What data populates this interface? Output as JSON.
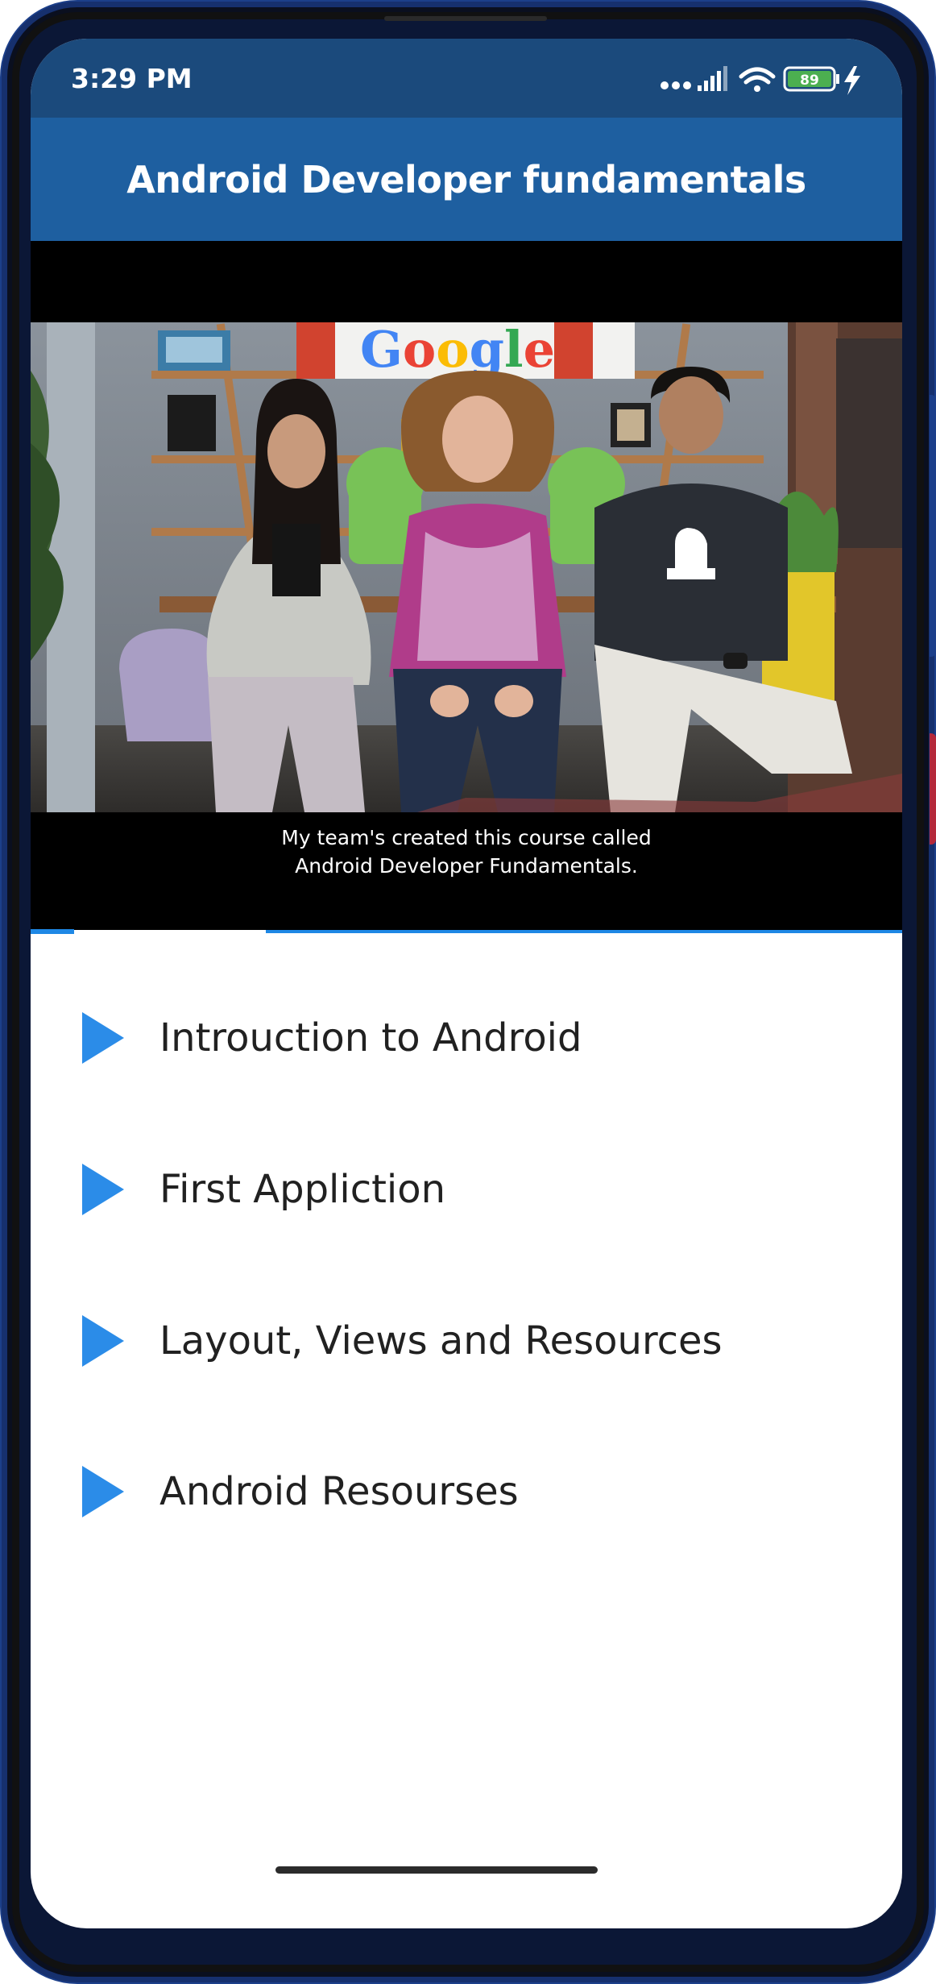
{
  "status_bar": {
    "time": "3:29 PM",
    "battery_level": "89",
    "icons": [
      "dots-icon",
      "signal-icon",
      "wifi-icon",
      "battery-icon",
      "charging-icon"
    ]
  },
  "app_bar": {
    "title": "Android Developer fundamentals"
  },
  "video": {
    "caption_line1": "My team's created this course called",
    "caption_line2": "Android Developer Fundamentals.",
    "progress_played": 0.05,
    "progress_buffered": 0.27,
    "scene_logo_text": "Google"
  },
  "lessons": [
    {
      "label": "Introuction to Android",
      "icon": "play-icon"
    },
    {
      "label": "First Appliction",
      "icon": "play-icon"
    },
    {
      "label": "Layout, Views and Resources",
      "icon": "play-icon"
    },
    {
      "label": "Android Resourses",
      "icon": "play-icon"
    }
  ],
  "colors": {
    "status_bar": "#1b4a7c",
    "app_bar": "#1e5fa0",
    "accent": "#1e88e5",
    "text": "#212121"
  }
}
